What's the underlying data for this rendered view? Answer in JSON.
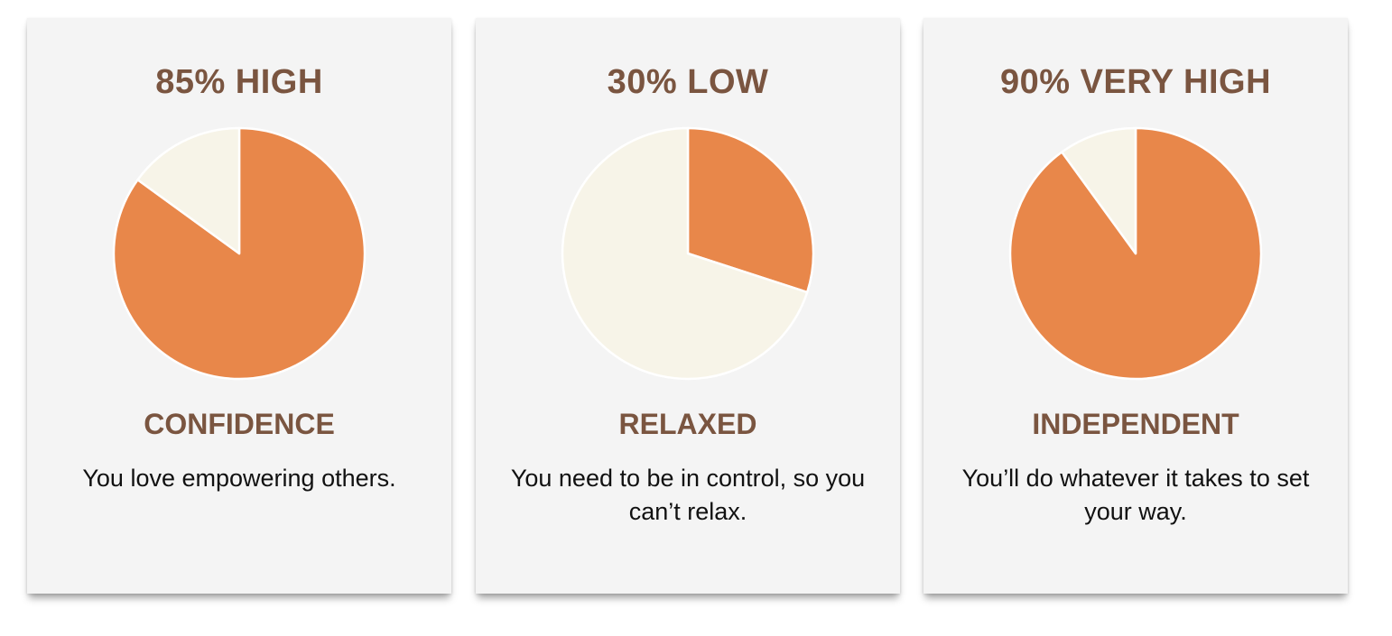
{
  "colors": {
    "filled": "#e8874a",
    "remaining": "#f7f4e8",
    "pie_stroke": "#ffffff",
    "heading": "#7a5540",
    "body_text": "#111111",
    "card_bg": "#f4f4f4"
  },
  "cards": [
    {
      "score_label": "85% HIGH",
      "trait": "CONFIDENCE",
      "description": "You love empowering others."
    },
    {
      "score_label": "30% LOW",
      "trait": "RELAXED",
      "description": "You need to be in control, so you can’t relax."
    },
    {
      "score_label": "90% VERY HIGH",
      "trait": "INDEPENDENT",
      "description": "You’ll do whatever it takes to set your way."
    }
  ],
  "chart_data": [
    {
      "type": "pie",
      "labels": [
        "",
        ""
      ],
      "values": [
        85,
        15
      ],
      "colors": [
        "#e8874a",
        "#f7f4e8"
      ]
    },
    {
      "type": "pie",
      "labels": [
        "",
        ""
      ],
      "values": [
        30,
        70
      ],
      "colors": [
        "#e8874a",
        "#f7f4e8"
      ]
    },
    {
      "type": "pie",
      "labels": [
        "",
        ""
      ],
      "values": [
        90,
        10
      ],
      "colors": [
        "#e8874a",
        "#f7f4e8"
      ]
    }
  ]
}
